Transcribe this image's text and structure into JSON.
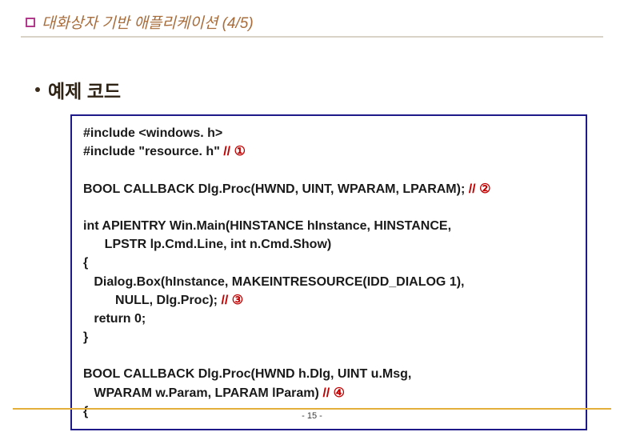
{
  "header": {
    "title": "대화상자 기반 애플리케이션 (4/5)"
  },
  "bullet": {
    "label": "예제 코드"
  },
  "code": {
    "l1": "#include <windows. h>",
    "l2a": "#include \"resource. h\" ",
    "l2b": "// ①",
    "l3": " ",
    "l4a": "BOOL CALLBACK Dlg.Proc(HWND, UINT, WPARAM, LPARAM); ",
    "l4b": "// ②",
    "l5": " ",
    "l6": "int APIENTRY Win.Main(HINSTANCE hInstance, HINSTANCE,",
    "l7": "      LPSTR lp.Cmd.Line, int n.Cmd.Show)",
    "l8": "{",
    "l9": "   Dialog.Box(hInstance, MAKEINTRESOURCE(IDD_DIALOG 1),",
    "l10a": "         NULL, Dlg.Proc); ",
    "l10b": "// ③",
    "l11": "   return 0;",
    "l12": "}",
    "l13": " ",
    "l14": "BOOL CALLBACK Dlg.Proc(HWND h.Dlg, UINT u.Msg,",
    "l15a": "   WPARAM w.Param, LPARAM lParam) ",
    "l15b": "// ④",
    "l16": "{"
  },
  "footer": {
    "page": "- 15 -"
  }
}
